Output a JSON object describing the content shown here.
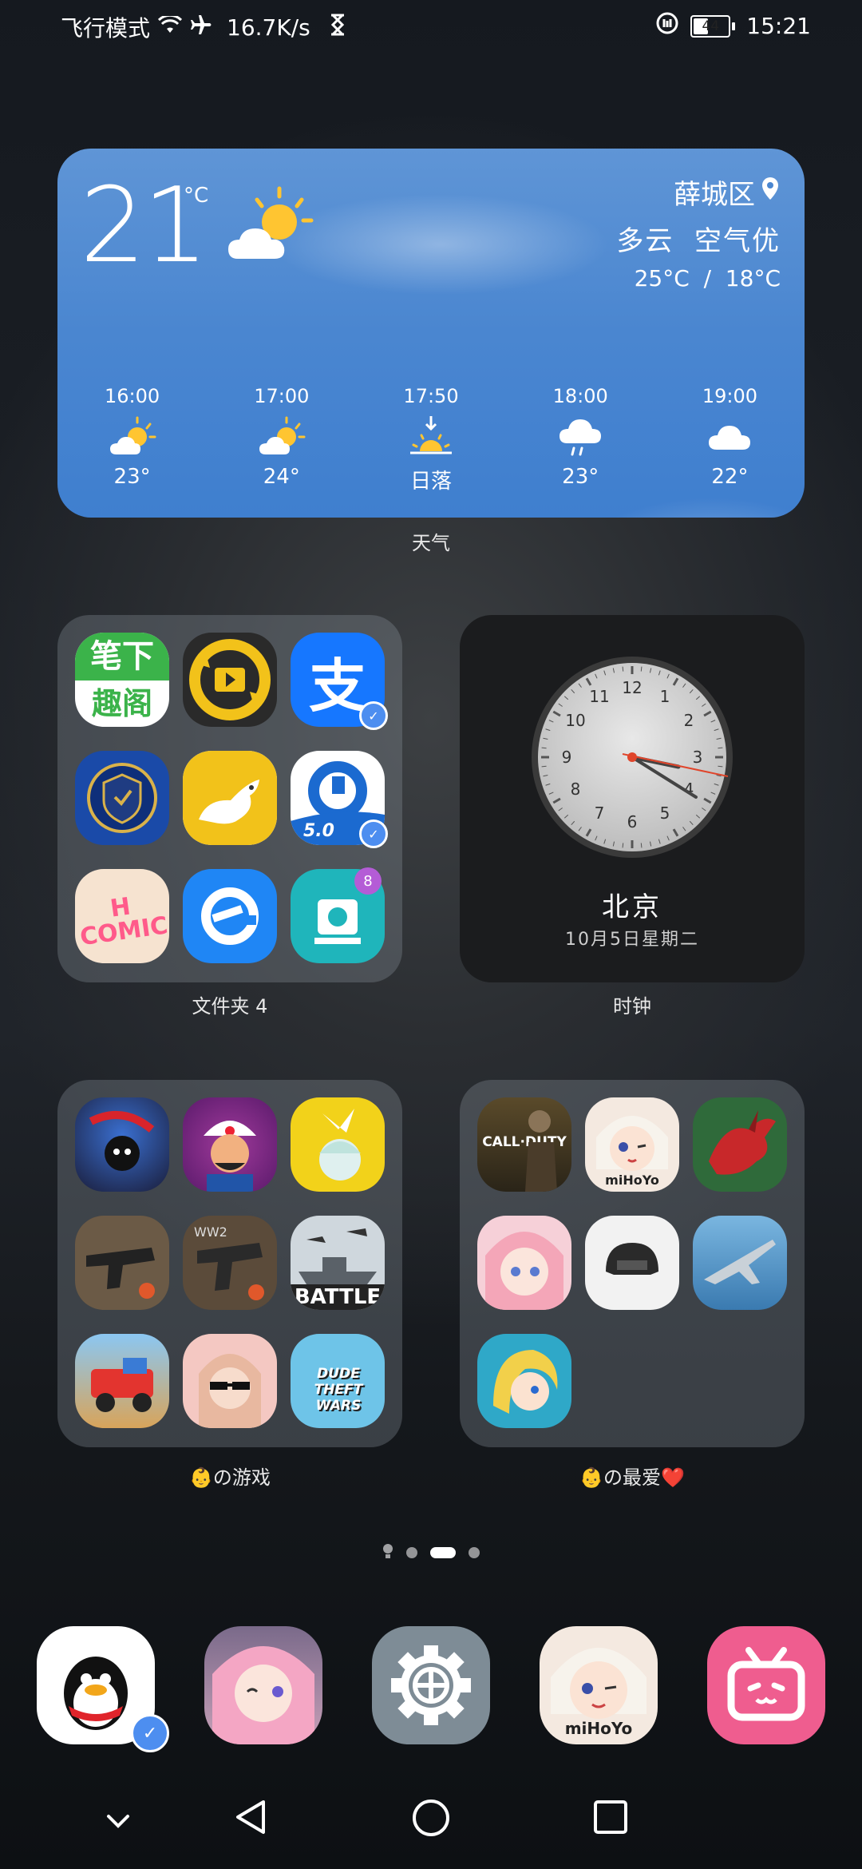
{
  "status_bar": {
    "mode": "飞行模式",
    "speed": "16.7K/s",
    "battery": "44",
    "battery_level": 0.44,
    "time": "15:21"
  },
  "weather": {
    "temp": "21",
    "unit": "°C",
    "location": "薛城区",
    "condition": "多云  空气优",
    "range": "25°C  /  18°C",
    "forecast": [
      {
        "time": "16:00",
        "icon": "partly-sunny-icon",
        "value": "23°"
      },
      {
        "time": "17:00",
        "icon": "partly-sunny-icon",
        "value": "24°"
      },
      {
        "time": "17:50",
        "icon": "sunset-icon",
        "value": "日落"
      },
      {
        "time": "18:00",
        "icon": "rain-icon",
        "value": "23°"
      },
      {
        "time": "19:00",
        "icon": "cloud-icon",
        "value": "22°"
      }
    ],
    "label": "天气"
  },
  "folder1": {
    "label": "文件夹 4",
    "notification_count": "8",
    "apps": [
      {
        "name": "bixia-reader-app",
        "text1": "笔下",
        "text2": "趣阁"
      },
      {
        "name": "video-app"
      },
      {
        "name": "alipay-app",
        "text": "支"
      },
      {
        "name": "anti-fraud-app"
      },
      {
        "name": "kangaroo-app"
      },
      {
        "name": "ccb-app",
        "text": "5.0"
      },
      {
        "name": "hcomic-app",
        "text": "H COMIC"
      },
      {
        "name": "ele-me-app"
      },
      {
        "name": "video-editor-app"
      }
    ]
  },
  "clock": {
    "city": "北京",
    "date": "10月5日星期二",
    "label": "时钟",
    "numbers": [
      "12",
      "1",
      "2",
      "3",
      "4",
      "5",
      "6",
      "7",
      "8",
      "9",
      "10",
      "11"
    ]
  },
  "folder2": {
    "label": "👶の游戏",
    "apps": [
      {
        "name": "shadow-fight-app"
      },
      {
        "name": "akinator-app"
      },
      {
        "name": "anime-girl-app"
      },
      {
        "name": "gun-armory-app"
      },
      {
        "name": "ww2-weapons-app"
      },
      {
        "name": "battleship-app",
        "text": "BATTLE"
      },
      {
        "name": "truck-game-app"
      },
      {
        "name": "anime-glasses-app"
      },
      {
        "name": "dude-theft-wars-app",
        "text": "DUDE THEFT WARS"
      }
    ]
  },
  "folder3": {
    "label": "👶の最爱❤️",
    "apps": [
      {
        "name": "call-of-duty-app",
        "text": "CALL·DUTY"
      },
      {
        "name": "genshin-app",
        "text": "miHoYo"
      },
      {
        "name": "dragon-app"
      },
      {
        "name": "pink-hair-girl-app"
      },
      {
        "name": "pubg-helmet-app"
      },
      {
        "name": "jet-fighter-app"
      },
      {
        "name": "blonde-hero-app"
      }
    ]
  },
  "dock": [
    {
      "name": "qq-app"
    },
    {
      "name": "anime-pink-app"
    },
    {
      "name": "settings-app"
    },
    {
      "name": "genshin-dock-app",
      "text": "miHoYo"
    },
    {
      "name": "bilibili-app"
    }
  ],
  "colors": {
    "weather_bg": "#4a86d0",
    "dock_pink": "#ef5d8f",
    "alipay": "#1677ff"
  }
}
